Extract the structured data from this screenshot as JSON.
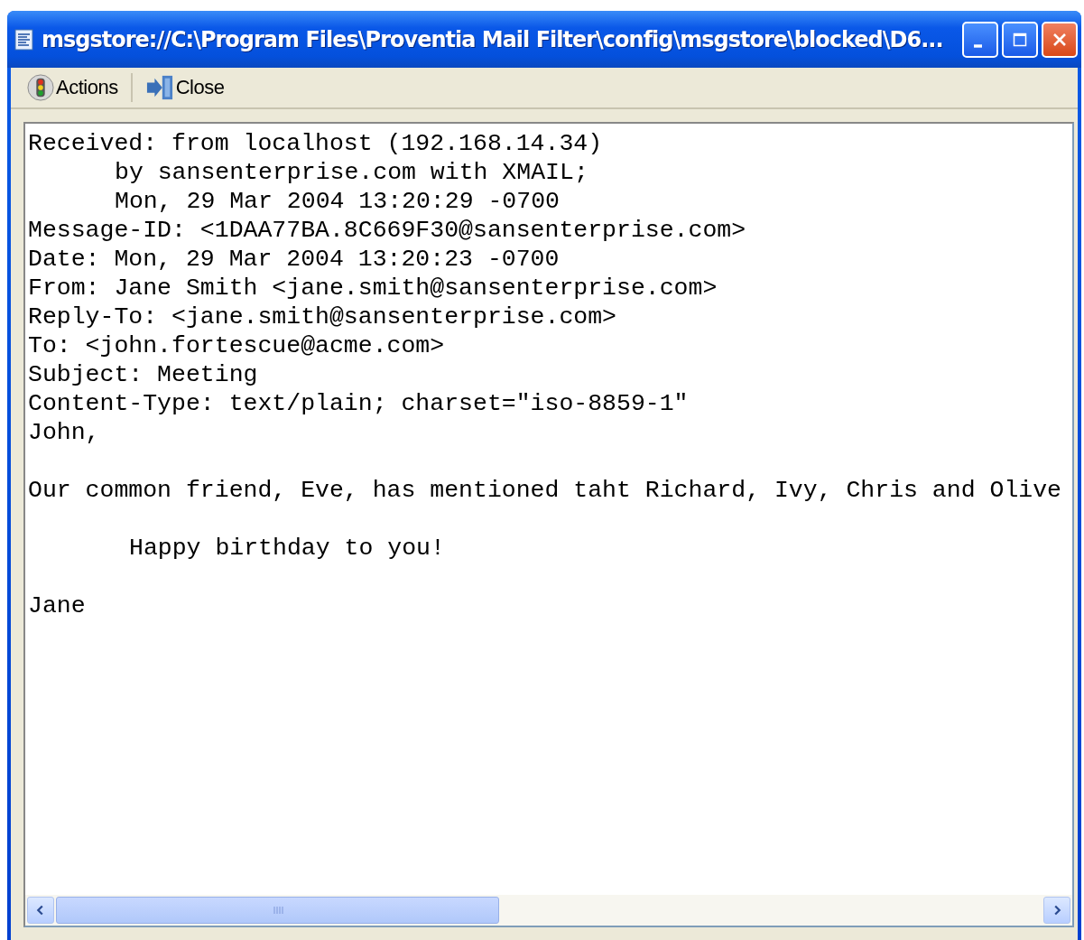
{
  "window": {
    "title": "msgstore://C:\\Program Files\\Proventia Mail Filter\\config\\msgstore\\blocked\\D6..."
  },
  "toolbar": [
    {
      "kind": "actions",
      "label": "Actions"
    },
    {
      "kind": "close",
      "label": "Close"
    }
  ],
  "message": {
    "paragraphs": [
      [
        {
          "kind": "plain",
          "text": "Received: from localhost (192.168.14.34)"
        },
        {
          "kind": "continuation",
          "text": "by sansenterprise.com with XMAIL;"
        },
        {
          "kind": "continuation",
          "text": "Mon, 29 Mar 2004 13:20:29 -0700"
        },
        {
          "kind": "plain",
          "text": "Message-ID: <1DAA77BA.8C669F30@sansenterprise.com>"
        },
        {
          "kind": "plain",
          "text": "Date: Mon, 29 Mar 2004 13:20:23 -0700"
        },
        {
          "kind": "plain",
          "text": "From: Jane Smith <jane.smith@sansenterprise.com>"
        },
        {
          "kind": "plain",
          "text": "Reply-To: <jane.smith@sansenterprise.com>"
        },
        {
          "kind": "plain",
          "text": "To: <john.fortescue@acme.com>"
        },
        {
          "kind": "plain",
          "text": "Subject: Meeting"
        },
        {
          "kind": "plain",
          "text": "Content-Type: text/plain; charset=\"iso-8859-1\""
        },
        {
          "kind": "plain",
          "text": "John,"
        }
      ],
      [
        {
          "kind": "plain",
          "text": "Our common friend, Eve, has mentioned taht Richard, Ivy, Chris and Olive"
        }
      ],
      [
        {
          "kind": "quote",
          "text": "Happy birthday to you!"
        }
      ],
      [
        {
          "kind": "plain",
          "text": "Jane"
        }
      ]
    ]
  }
}
